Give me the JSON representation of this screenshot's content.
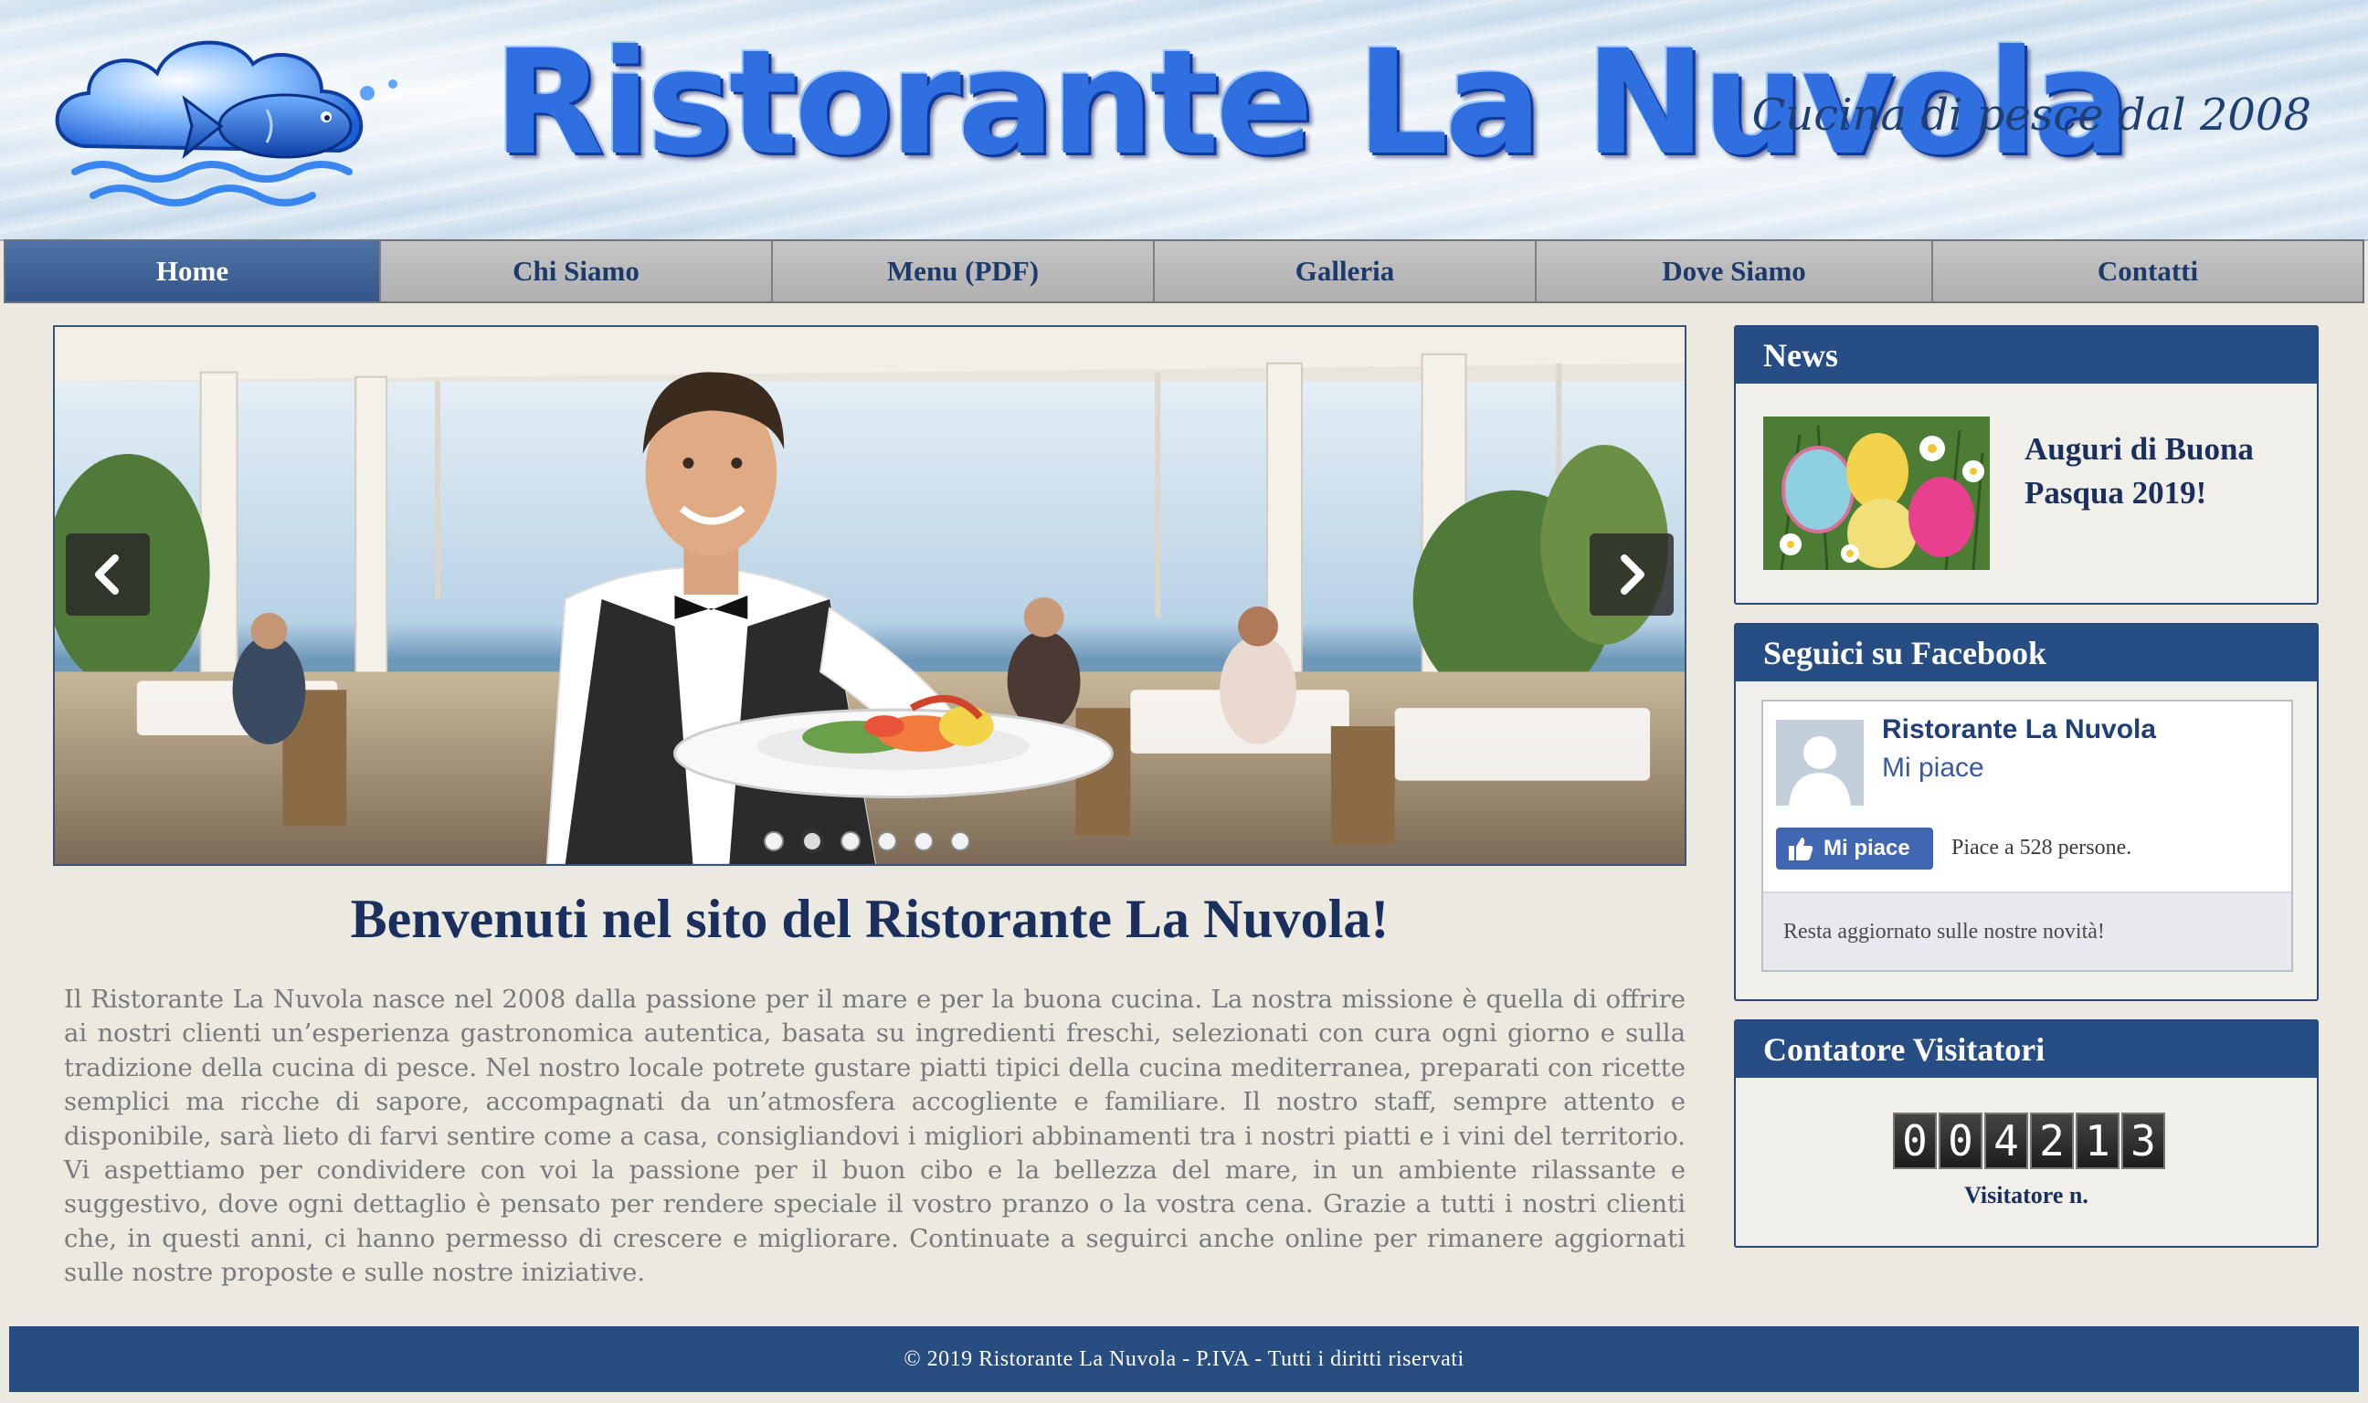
{
  "header": {
    "title": "Ristorante La Nuvola",
    "tagline": "Cucina di pesce dal 2008",
    "logo_icon": "cloud-fish-logo"
  },
  "nav": {
    "items": [
      {
        "label": "Home",
        "active": true
      },
      {
        "label": "Chi Siamo",
        "active": false
      },
      {
        "label": "Menu (PDF)",
        "active": false
      },
      {
        "label": "Galleria",
        "active": false
      },
      {
        "label": "Dove Siamo",
        "active": false
      },
      {
        "label": "Contatti",
        "active": false
      }
    ]
  },
  "slider": {
    "prev_icon": "chevron-left-icon",
    "next_icon": "chevron-right-icon",
    "slide_count": 6,
    "active_slide": 2
  },
  "main": {
    "welcome_title": "Benvenuti nel sito del Ristorante La Nuvola!",
    "intro": "Il Ristorante La Nuvola nasce nel 2008 dalla passione per il mare e per la buona cucina. La nostra missione è quella di offrire ai nostri clienti un’esperienza gastronomica autentica, basata su ingredienti freschi, selezionati con cura ogni giorno e sulla tradizione della cucina di pesce. Nel nostro locale potrete gustare piatti tipici della cucina mediterranea, preparati con ricette semplici ma ricche di sapore, accompagnati da un’atmosfera accogliente e familiare. Il nostro staff, sempre attento e disponibile, sarà lieto di farvi sentire come a casa, consigliandovi i migliori abbinamenti tra i nostri piatti e i vini del territorio. Vi aspettiamo per condividere con voi la passione per il buon cibo e la bellezza del mare, in un ambiente rilassante e suggestivo, dove ogni dettaglio è pensato per rendere speciale il vostro pranzo o la vostra cena. Grazie a tutti i nostri clienti che, in questi anni, ci hanno permesso di crescere e migliorare. Continuate a seguirci anche online per rimanere aggiornati sulle nostre proposte e sulle nostre iniziative."
  },
  "sidebar": {
    "news": {
      "heading": "News",
      "item_title": "Auguri di Buona Pasqua 2019!"
    },
    "facebook": {
      "heading": "Seguici su Facebook",
      "page_name": "Ristorante La Nuvola",
      "page_like_link": "Mi piace",
      "like_button": "Mi piace",
      "like_count_text": "Piace a 528 persone.",
      "footer_text": "Resta aggiornato sulle nostre novità!"
    },
    "counter": {
      "heading": "Contatore Visitatori",
      "digits": [
        "0",
        "0",
        "4",
        "2",
        "1",
        "3"
      ],
      "label": "Visitatore n."
    }
  },
  "footer": {
    "text": "© 2019 Ristorante La Nuvola  -  P.IVA  -  Tutti  i  diritti riservati"
  },
  "colors": {
    "nav_active": "#34568a",
    "panel_header": "#274e84",
    "footer_bg": "#284d80",
    "title_text": "#1a2f5e"
  }
}
